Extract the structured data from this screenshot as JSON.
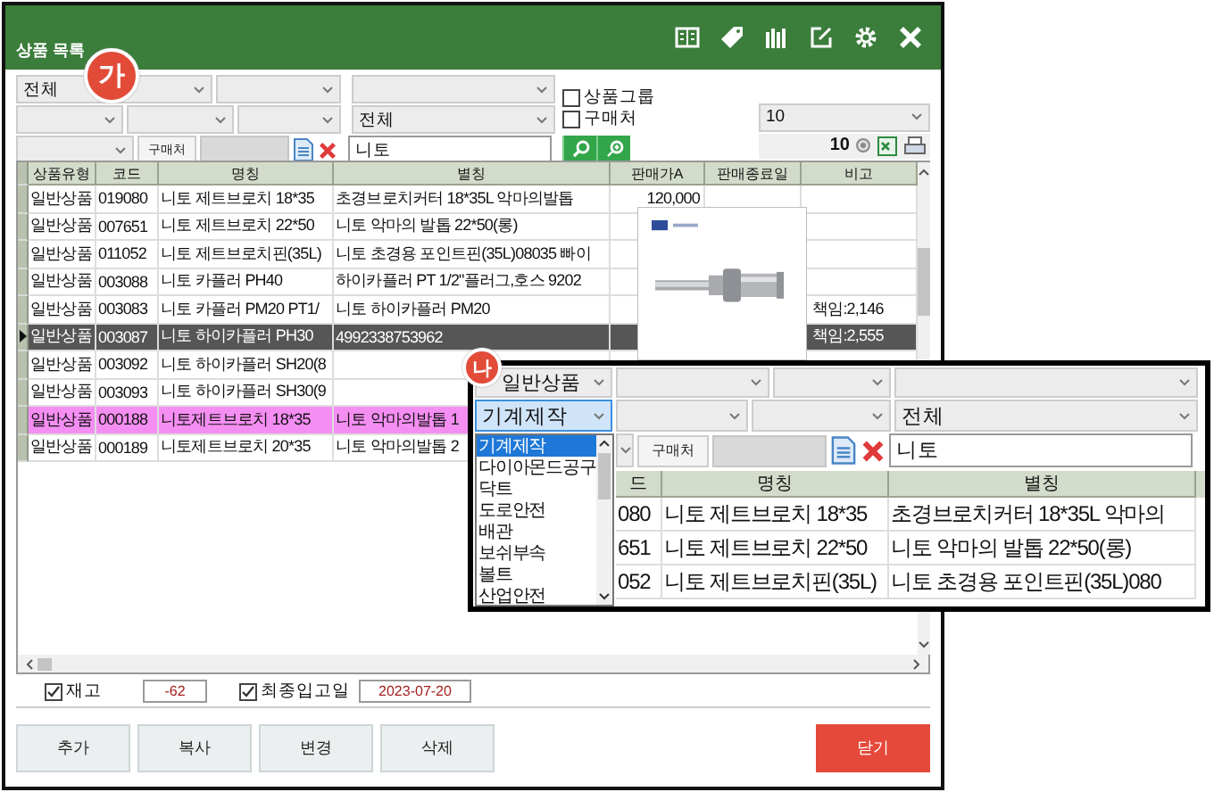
{
  "window": {
    "title": "상품 목록"
  },
  "filters": {
    "badge": "가",
    "category_select": "전체",
    "type_select": "전체",
    "product_group": {
      "label": "상품그룹",
      "checked": false
    },
    "supplier_filter": {
      "label": "구매처",
      "checked": false
    },
    "supplier_button": "구매처",
    "search": {
      "value": "니토"
    },
    "page_size": "10",
    "count": "10"
  },
  "table": {
    "columns": [
      "상품유형",
      "코드",
      "명칭",
      "별칭",
      "판매가A",
      "판매종료일",
      "비고"
    ],
    "rows": [
      {
        "type": "일반상품",
        "code": "019080",
        "name": "니토 제트브로치 18*35",
        "alias": "초경브로치커터 18*35L 악마의발톱",
        "price": "120,000",
        "selected": false,
        "highlighted": false
      },
      {
        "type": "일반상품",
        "code": "007651",
        "name": "니토 제트브로치 22*50",
        "alias": "니토 악마의 발톱 22*50(롱)",
        "selected": false,
        "highlighted": false
      },
      {
        "type": "일반상품",
        "code": "011052",
        "name": "니토 제트브로치핀(35L)",
        "alias": "니토 초경용 포인트핀(35L)08035 빠이",
        "selected": false,
        "highlighted": false
      },
      {
        "type": "일반상품",
        "code": "003088",
        "name": "니토 카플러 PH40",
        "alias": "하이카플러 PT 1/2\"플러그,호스  9202",
        "selected": false,
        "highlighted": false
      },
      {
        "type": "일반상품",
        "code": "003083",
        "name": "니토 카플러 PM20 PT1/",
        "alias": "니토 하이카플러 PM20",
        "note": "책임:2,146",
        "selected": false,
        "highlighted": false
      },
      {
        "type": "일반상품",
        "code": "003087",
        "name": "니토 하이카플러 PH30",
        "alias": "4992338753962",
        "note": "책임:2,555",
        "selected": true,
        "highlighted": false
      },
      {
        "type": "일반상품",
        "code": "003092",
        "name": "니토 하이카플러 SH20(8",
        "selected": false,
        "highlighted": false
      },
      {
        "type": "일반상품",
        "code": "003093",
        "name": "니토 하이카플러 SH30(9",
        "selected": false,
        "highlighted": false
      },
      {
        "type": "일반상품",
        "code": "000188",
        "name": "니토제트브로치 18*35",
        "alias": "니토 악마의발톱 1",
        "selected": false,
        "highlighted": true
      },
      {
        "type": "일반상품",
        "code": "000189",
        "name": "니토제트브로치 20*35",
        "alias": "니토 악마의발톱 2",
        "selected": false,
        "highlighted": false
      }
    ]
  },
  "inset": {
    "badge": "나",
    "type_select": "일반상품",
    "category_select": "기계제작",
    "category_options": [
      {
        "label": "기계제작",
        "selected": true
      },
      {
        "label": "다이아몬드공구",
        "selected": false
      },
      {
        "label": "닥트",
        "selected": false
      },
      {
        "label": "도로안전",
        "selected": false
      },
      {
        "label": "배관",
        "selected": false
      },
      {
        "label": "보쉬부속",
        "selected": false
      },
      {
        "label": "볼트",
        "selected": false
      },
      {
        "label": "산업안전",
        "selected": false
      }
    ],
    "group_select": "전체",
    "supplier_button": "구매처",
    "search": {
      "value": "니토"
    },
    "columns": [
      "드",
      "명칭",
      "별칭"
    ],
    "rows": [
      [
        "080",
        "니토 제트브로치 18*35",
        "초경브로치커터 18*35L 악마의"
      ],
      [
        "651",
        "니토 제트브로치 22*50",
        "니토 악마의 발톱 22*50(롱)"
      ],
      [
        "052",
        "니토 제트브로치핀(35L)",
        "니토 초경용 포인트핀(35L)080"
      ]
    ]
  },
  "footer": {
    "stock": {
      "label": "재고",
      "checked": true,
      "value": "-62"
    },
    "last_received": {
      "label": "최종입고일",
      "checked": true,
      "value": "2023-07-20"
    },
    "buttons": [
      "추가",
      "복사",
      "변경",
      "삭제"
    ],
    "close_button": "닫기"
  }
}
